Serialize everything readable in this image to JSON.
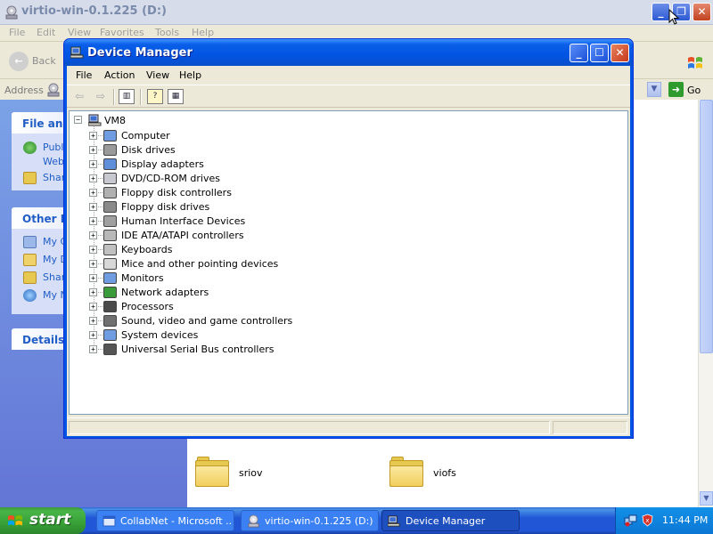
{
  "explorer": {
    "title": "virtio-win-0.1.225 (D:)",
    "menu": [
      "File",
      "Edit",
      "View",
      "Favorites",
      "Tools",
      "Help"
    ],
    "back_label": "Back",
    "address_label": "Address",
    "go_label": "Go",
    "panels": {
      "file_tasks": {
        "title": "File and",
        "items": [
          "Publi",
          "Web",
          "Shar"
        ]
      },
      "other_places": {
        "title": "Other Pl",
        "items": [
          "My C",
          "My D",
          "Shar",
          "My N"
        ]
      },
      "details": {
        "title": "Details"
      }
    },
    "folders": [
      {
        "name": "sriov"
      },
      {
        "name": "viofs"
      }
    ]
  },
  "device_manager": {
    "title": "Device Manager",
    "menu": [
      "File",
      "Action",
      "View",
      "Help"
    ],
    "tree": {
      "root": "VM8",
      "categories": [
        {
          "label": "Computer",
          "icon": "computer-icon"
        },
        {
          "label": "Disk drives",
          "icon": "disk-drive-icon"
        },
        {
          "label": "Display adapters",
          "icon": "display-adapter-icon"
        },
        {
          "label": "DVD/CD-ROM drives",
          "icon": "cdrom-icon"
        },
        {
          "label": "Floppy disk controllers",
          "icon": "floppy-controller-icon"
        },
        {
          "label": "Floppy disk drives",
          "icon": "floppy-drive-icon"
        },
        {
          "label": "Human Interface Devices",
          "icon": "hid-icon"
        },
        {
          "label": "IDE ATA/ATAPI controllers",
          "icon": "ide-controller-icon"
        },
        {
          "label": "Keyboards",
          "icon": "keyboard-icon"
        },
        {
          "label": "Mice and other pointing devices",
          "icon": "mouse-icon"
        },
        {
          "label": "Monitors",
          "icon": "monitor-icon"
        },
        {
          "label": "Network adapters",
          "icon": "network-adapter-icon"
        },
        {
          "label": "Processors",
          "icon": "processor-icon"
        },
        {
          "label": "Sound, video and game controllers",
          "icon": "sound-icon"
        },
        {
          "label": "System devices",
          "icon": "system-device-icon"
        },
        {
          "label": "Universal Serial Bus controllers",
          "icon": "usb-icon"
        }
      ]
    }
  },
  "taskbar": {
    "start_label": "start",
    "tasks": [
      {
        "label": "CollabNet - Microsoft ...",
        "active": false
      },
      {
        "label": "virtio-win-0.1.225 (D:)",
        "active": false
      },
      {
        "label": "Device Manager",
        "active": true
      }
    ],
    "clock": "11:44 PM"
  }
}
